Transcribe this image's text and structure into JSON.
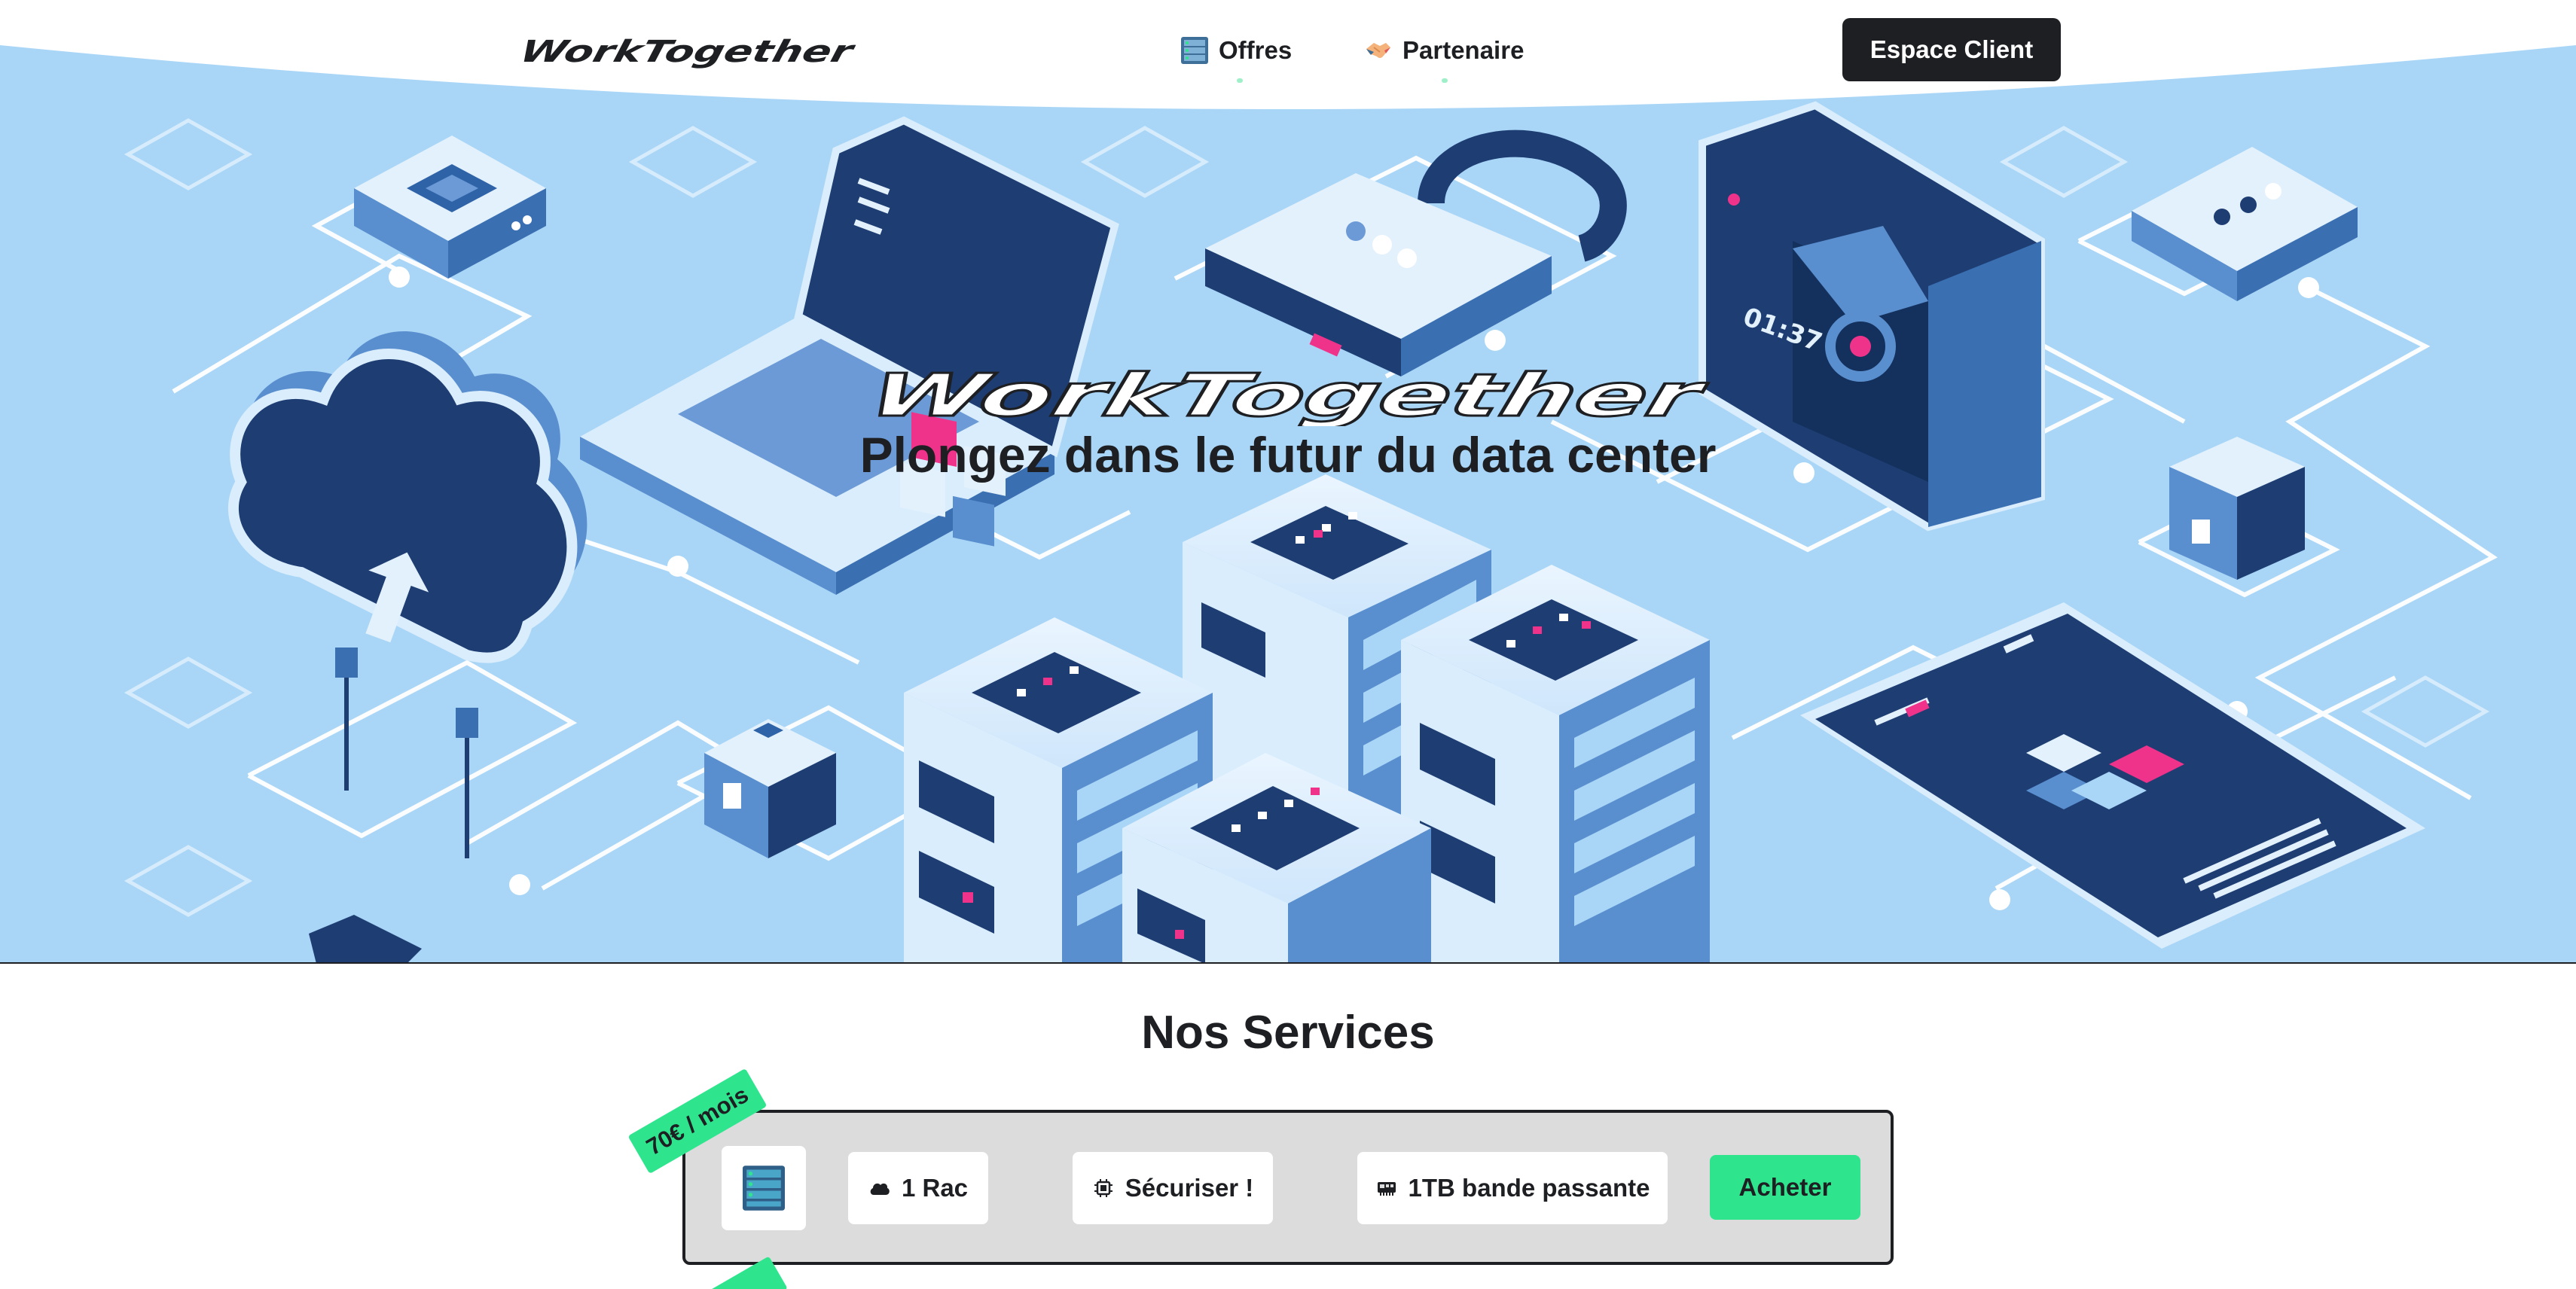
{
  "nav": {
    "brand": "WorkTogether",
    "links": [
      {
        "label": "Offres",
        "icon": "server-rack-icon"
      },
      {
        "label": "Partenaire",
        "icon": "handshake-icon"
      }
    ],
    "client_button": "Espace Client"
  },
  "hero": {
    "logo_text": "WorkTogether",
    "subtitle": "Plongez dans le futur du data center",
    "illustration": "isometric-datacenter-illustration"
  },
  "services": {
    "title": "Nos Services",
    "cards": [
      {
        "price": "70€ / mois",
        "image_icon": "server-rack-icon",
        "features": [
          {
            "icon": "cloud-icon",
            "label": "1 Rac"
          },
          {
            "icon": "chip-icon",
            "label": "Sécuriser !"
          },
          {
            "icon": "network-card-icon",
            "label": "1TB bande passante"
          }
        ],
        "buy_label": "Acheter"
      }
    ]
  },
  "colors": {
    "hero_background": "#a9d6f7",
    "dark": "#1e1f22",
    "accent_green": "#2ee58e",
    "card_background": "#dcdcdc",
    "navy": "#1d3d73",
    "magenta": "#f0338a"
  }
}
